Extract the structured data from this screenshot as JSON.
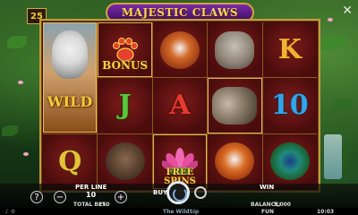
{
  "game": {
    "title": "MAJESTIC CLAWS",
    "lines_count": "25",
    "close_symbol": "✕"
  },
  "reels": [
    [
      "wild-tiger",
      "Q",
      "Q"
    ],
    [
      "bonus-paw",
      "J",
      "bear"
    ],
    [
      "red-panda",
      "A",
      "free-spins-lotus"
    ],
    [
      "elephant",
      "elephants",
      "red-panda"
    ],
    [
      "K",
      "10",
      "peacock"
    ]
  ],
  "symbols": {
    "wild_label": "WILD",
    "bonus_label": "BONUS",
    "free_spins_label": "FREE\nSPINS",
    "letter_J": "J",
    "letter_A": "A",
    "letter_K": "K",
    "number_10": "10",
    "letter_Q": "Q"
  },
  "controls": {
    "help": "?",
    "per_line_label": "PER LINE",
    "per_line_value": "10",
    "minus": "−",
    "plus": "+",
    "total_bet_label": "TOTAL BET:",
    "total_bet_value": "250",
    "buy_label": "BUY",
    "win_label": "WIN",
    "balance_label": "BALANCE:",
    "balance_value": "5,000",
    "currency": "FUN",
    "time": "10:03",
    "brand": "The WildSip"
  },
  "colors": {
    "frame_gold": "#c69a3e",
    "reel_bg": "#4a0c0c",
    "logo_purple": "#6a249a"
  },
  "icons": [
    "close-icon",
    "help-icon",
    "minus-icon",
    "plus-icon",
    "spin-icon",
    "autoplay-icon",
    "sound-icon",
    "settings-icon"
  ]
}
